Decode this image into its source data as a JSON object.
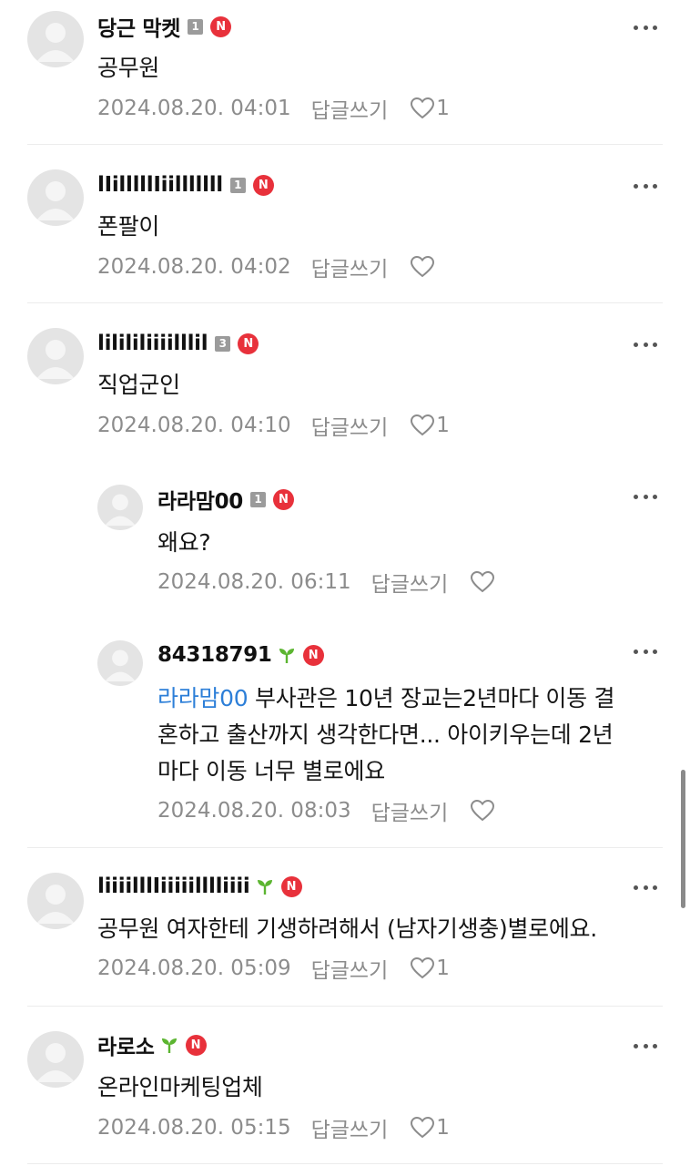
{
  "comments": [
    {
      "author": "당근 막켓",
      "badge": "level",
      "level": "1",
      "text": "공무원",
      "date": "2024.08.20. 04:01",
      "reply": "답글쓰기",
      "likes": "1"
    },
    {
      "author": "lIilllllIiilllllll",
      "badge": "level",
      "level": "1",
      "text": "폰팔이",
      "date": "2024.08.20. 04:02",
      "reply": "답글쓰기",
      "likes": ""
    },
    {
      "author": "lilililiiiilllil",
      "badge": "level",
      "level": "3",
      "text": "직업군인",
      "date": "2024.08.20. 04:10",
      "reply": "답글쓰기",
      "likes": "1"
    },
    {
      "author": "라라맘00",
      "badge": "level",
      "level": "1",
      "text": "왜요?",
      "date": "2024.08.20. 06:11",
      "reply": "답글쓰기",
      "likes": ""
    },
    {
      "author": "84318791",
      "badge": "sprout",
      "mention": "라라맘00",
      "text_lines": [
        " 부사관은 10년 장교는2년마다 이동 결",
        "혼하고 출산까지 생각한다면... 아이키우는데 2년",
        "마다 이동 너무 별로에요"
      ],
      "date": "2024.08.20. 08:03",
      "reply": "답글쓰기",
      "likes": ""
    },
    {
      "author": "liiiilllIiiiiilllliiii",
      "badge": "sprout",
      "text": "공무원 여자한테 기생하려해서 (남자기생충)별로에요.",
      "date": "2024.08.20. 05:09",
      "reply": "답글쓰기",
      "likes": "1"
    },
    {
      "author": "라로소",
      "badge": "sprout",
      "text": "온라인마케팅업체",
      "date": "2024.08.20. 05:15",
      "reply": "답글쓰기",
      "likes": "1"
    }
  ],
  "n_badge_label": "N",
  "icons": {
    "more": "more-icon",
    "like": "heart-outline-icon",
    "avatar": "default-avatar-icon",
    "sprout": "sprout-icon"
  },
  "colors": {
    "n_badge": "#e8313b",
    "mention": "#2d7fd8",
    "sprout": "#5cb531",
    "meta": "#8c8c8c"
  }
}
